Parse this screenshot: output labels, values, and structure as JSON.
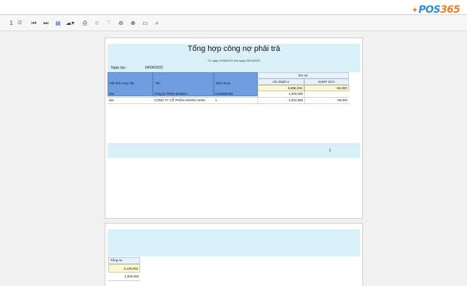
{
  "toolbar": {
    "page_current": "1",
    "page_total": "/2",
    "buttons": [
      {
        "name": "first-page-icon",
        "glyph": "⏮"
      },
      {
        "name": "next-page-icon",
        "glyph": "⏭"
      },
      {
        "name": "export-doc-icon",
        "glyph": "▤"
      },
      {
        "name": "cloud-download-icon",
        "glyph": "☁▾"
      },
      {
        "name": "print-icon",
        "glyph": "⎙"
      },
      {
        "name": "link-icon",
        "glyph": "⊘"
      },
      {
        "name": "filter-icon",
        "glyph": "⊤"
      },
      {
        "name": "zoom-out-icon",
        "glyph": "⊖"
      },
      {
        "name": "zoom-in-icon",
        "glyph": "⊕"
      },
      {
        "name": "monitor-icon",
        "glyph": "▭"
      },
      {
        "name": "search-icon",
        "glyph": "⌕"
      }
    ]
  },
  "logo": {
    "mark": "✦",
    "part1": "POS",
    "part2": "365"
  },
  "report": {
    "title": "Tổng hợp công nợ phải trả",
    "subtitle": "Từ ngày 29/03/2022 đến ngày 04/04/2022",
    "created_label": "Ngày tạo :",
    "created_value": "04/04/2022",
    "headers": {
      "code": "Mã nhà cung cấp",
      "name": "Tên",
      "phone": "Điện thoại",
      "debt": "Dư nợ",
      "branch1": "chi nhánh 2",
      "branch2": "SHOP SỮA"
    },
    "totals": {
      "branch1": "8,895,000",
      "branch2": "-65,000"
    },
    "rows": [
      {
        "code": "222",
        "name": "Công ty TNHH BONIKA",
        "phone": "0123456789",
        "branch1": "4,200,000",
        "branch2": ""
      },
      {
        "code": "abc",
        "name": "CÔNG TY CỔ PHẦN HOÀNG NINH",
        "phone": "1",
        "branch1": "-1,004,998",
        "branch2": "-65,000"
      }
    ],
    "page_number": "1"
  },
  "page2": {
    "total_header": "Tổng nợ",
    "total_value": "8,130,002",
    "row_value": "4,200,000"
  }
}
